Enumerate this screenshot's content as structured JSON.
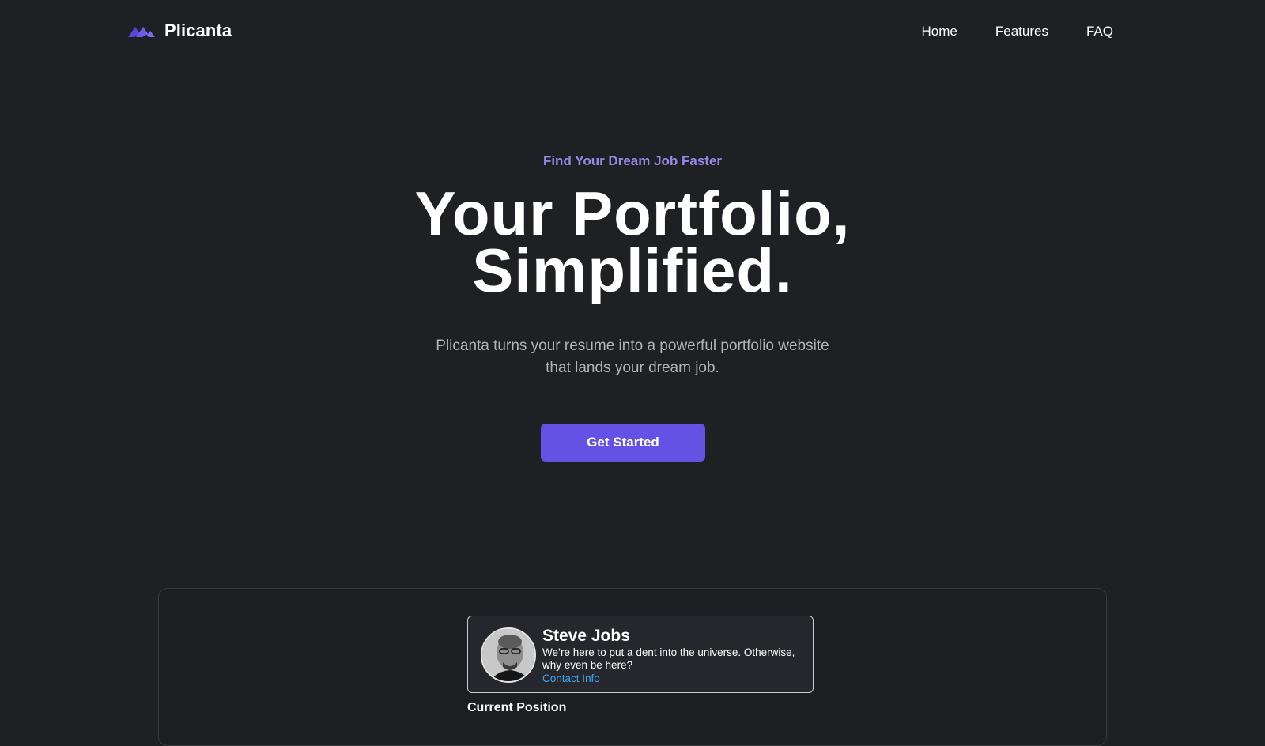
{
  "nav": {
    "brand": "Plicanta",
    "links": [
      "Home",
      "Features",
      "FAQ"
    ]
  },
  "hero": {
    "eyebrow": "Find Your Dream Job Faster",
    "headline_line1": "Your Portfolio,",
    "headline_line2": "Simplified.",
    "subtext": "Plicanta turns your resume into a powerful portfolio website that lands your dream job.",
    "cta_label": "Get Started"
  },
  "preview": {
    "name": "Steve Jobs",
    "quote": "We’re here to put a dent into the universe. Otherwise, why even be here?",
    "contact_label": "Contact Info",
    "section_label": "Current Position"
  },
  "colors": {
    "background": "#1f2024",
    "accent": "#6352e4",
    "eyebrow": "#9a86e6",
    "link": "#3aa6f0"
  }
}
